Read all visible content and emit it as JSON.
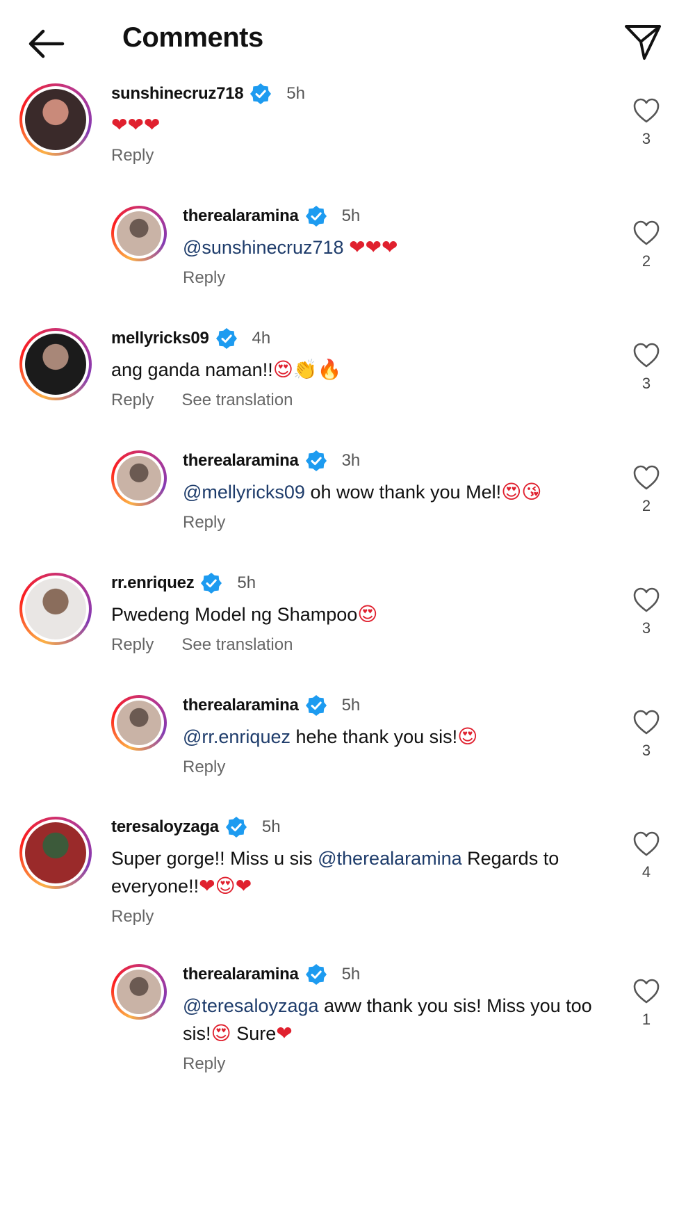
{
  "header": {
    "title": "Comments"
  },
  "comments": [
    {
      "username": "sunshinecruz718",
      "time": "5h",
      "likes": "3",
      "segments": [
        {
          "t": "text",
          "v": ""
        },
        {
          "t": "emoji",
          "v": "❤❤❤"
        }
      ],
      "actions": [
        "Reply"
      ]
    },
    {
      "username": "therealaramina",
      "time": "5h",
      "likes": "2",
      "segments": [
        {
          "t": "mention",
          "v": "@sunshinecruz718"
        },
        {
          "t": "text",
          "v": " "
        },
        {
          "t": "emoji",
          "v": "❤❤❤"
        }
      ],
      "actions": [
        "Reply"
      ]
    },
    {
      "username": "mellyricks09",
      "time": "4h",
      "likes": "3",
      "segments": [
        {
          "t": "text",
          "v": "ang ganda naman!!"
        },
        {
          "t": "emoji",
          "v": "😍👏🔥"
        }
      ],
      "actions": [
        "Reply",
        "See translation"
      ]
    },
    {
      "username": "therealaramina",
      "time": "3h",
      "likes": "2",
      "segments": [
        {
          "t": "mention",
          "v": "@mellyricks09"
        },
        {
          "t": "text",
          "v": " oh wow thank you Mel!"
        },
        {
          "t": "emoji",
          "v": "😍😘"
        }
      ],
      "actions": [
        "Reply"
      ]
    },
    {
      "username": "rr.enriquez",
      "time": "5h",
      "likes": "3",
      "segments": [
        {
          "t": "text",
          "v": "Pwedeng Model ng Shampoo"
        },
        {
          "t": "emoji",
          "v": "😍"
        }
      ],
      "actions": [
        "Reply",
        "See translation"
      ]
    },
    {
      "username": "therealaramina",
      "time": "5h",
      "likes": "3",
      "segments": [
        {
          "t": "mention",
          "v": "@rr.enriquez"
        },
        {
          "t": "text",
          "v": " hehe thank you sis!"
        },
        {
          "t": "emoji",
          "v": "😍"
        }
      ],
      "actions": [
        "Reply"
      ]
    },
    {
      "username": "teresaloyzaga",
      "time": "5h",
      "likes": "4",
      "segments": [
        {
          "t": "text",
          "v": "Super gorge!! Miss u sis "
        },
        {
          "t": "mention",
          "v": "@therealaramina"
        },
        {
          "t": "text",
          "v": " Regards to everyone!!"
        },
        {
          "t": "emoji",
          "v": "❤😍❤"
        }
      ],
      "actions": [
        "Reply"
      ]
    },
    {
      "username": "therealaramina",
      "time": "5h",
      "likes": "1",
      "segments": [
        {
          "t": "mention",
          "v": "@teresaloyzaga"
        },
        {
          "t": "text",
          "v": " aww thank you sis! Miss you too sis!"
        },
        {
          "t": "emoji",
          "v": "😍"
        },
        {
          "t": "text",
          "v": " Sure"
        },
        {
          "t": "emoji",
          "v": "❤"
        }
      ],
      "actions": [
        "Reply"
      ]
    }
  ],
  "colors": {
    "verified": "#1d9bf0",
    "mention": "#1e3c6b",
    "heart_emoji": "#e0202e"
  },
  "icons": {
    "back": "arrow-left-icon",
    "share": "paper-plane-icon",
    "verified": "verified-badge-icon",
    "like": "heart-outline-icon"
  }
}
